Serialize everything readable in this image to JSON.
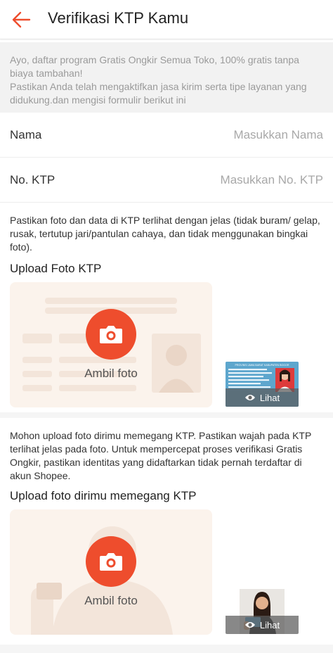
{
  "header": {
    "title": "Verifikasi KTP Kamu"
  },
  "info": {
    "line1": "Ayo, daftar program Gratis Ongkir Semua Toko, 100% gratis tanpa biaya tambahan!",
    "line2": "Pastikan Anda telah mengaktifkan jasa kirim serta tipe layanan yang didukung.dan mengisi formulir berikut ini"
  },
  "form": {
    "name_label": "Nama",
    "name_placeholder": "Masukkan Nama",
    "ktp_label": "No. KTP",
    "ktp_placeholder": "Masukkan No. KTP"
  },
  "ktp_upload": {
    "note": "Pastikan foto dan data di KTP terlihat dengan jelas (tidak buram/ gelap, rusak, tertutup jari/pantulan cahaya, dan tidak menggunakan bingkai foto).",
    "title": "Upload Foto KTP",
    "button_label": "Ambil foto",
    "view_label": "Lihat",
    "sample_id_header": "PROVINSI JAWA BARAT KABUPATEN BOGOR"
  },
  "selfie_upload": {
    "note": "Mohon upload foto dirimu memegang KTP. Pastikan wajah pada KTP terlihat jelas pada foto. Untuk mempercepat proses verifikasi Gratis Ongkir, pastikan identitas yang didaftarkan tidak pernah terdaftar di akun Shopee.",
    "title": "Upload foto dirimu memegang KTP",
    "button_label": "Ambil foto",
    "view_label": "Lihat"
  },
  "colors": {
    "accent": "#ee4d2d",
    "placeholder_card": "#fbf3ec"
  }
}
